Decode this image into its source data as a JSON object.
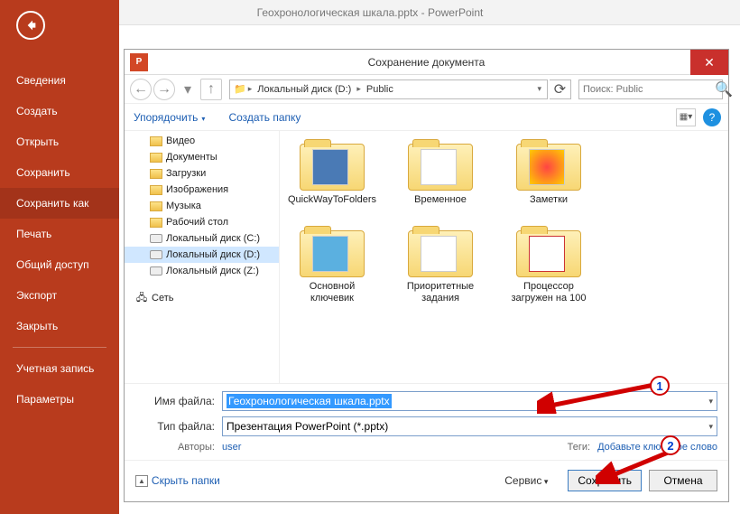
{
  "window_title": "Геохронологическая шкала.pptx - PowerPoint",
  "sidebar": {
    "items": [
      "Сведения",
      "Создать",
      "Открыть",
      "Сохранить",
      "Сохранить как",
      "Печать",
      "Общий доступ",
      "Экспорт",
      "Закрыть"
    ],
    "selected_index": 4,
    "items2": [
      "Учетная запись",
      "Параметры"
    ]
  },
  "dialog": {
    "title": "Сохранение документа",
    "path": {
      "drive": "Локальный диск (D:)",
      "folder": "Public"
    },
    "search_placeholder": "Поиск: Public",
    "toolbar": {
      "organize": "Упорядочить",
      "newfolder": "Создать папку"
    },
    "tree": [
      {
        "label": "Видео",
        "type": "folder"
      },
      {
        "label": "Документы",
        "type": "folder"
      },
      {
        "label": "Загрузки",
        "type": "folder"
      },
      {
        "label": "Изображения",
        "type": "folder"
      },
      {
        "label": "Музыка",
        "type": "folder"
      },
      {
        "label": "Рабочий стол",
        "type": "folder"
      },
      {
        "label": "Локальный диск (C:)",
        "type": "drive"
      },
      {
        "label": "Локальный диск (D:)",
        "type": "drive",
        "selected": true
      },
      {
        "label": "Локальный диск (Z:)",
        "type": "drive"
      }
    ],
    "tree_network": "Сеть",
    "files": [
      "QuickWayToFolders",
      "Временное",
      "Заметки",
      "Основной ключевик",
      "Приоритетные задания",
      "Процессор загружен на 100"
    ],
    "filename_label": "Имя файла:",
    "filetype_label": "Тип файла:",
    "filename": "Геохронологическая шкала.pptx",
    "filetype": "Презентация PowerPoint (*.pptx)",
    "authors_label": "Авторы:",
    "authors": "user",
    "tags_label": "Теги:",
    "tags": "Добавьте ключевое слово",
    "hide_folders": "Скрыть папки",
    "service": "Сервис",
    "save": "Сохранить",
    "cancel": "Отмена"
  },
  "annotations": {
    "n1": "1",
    "n2": "2"
  }
}
